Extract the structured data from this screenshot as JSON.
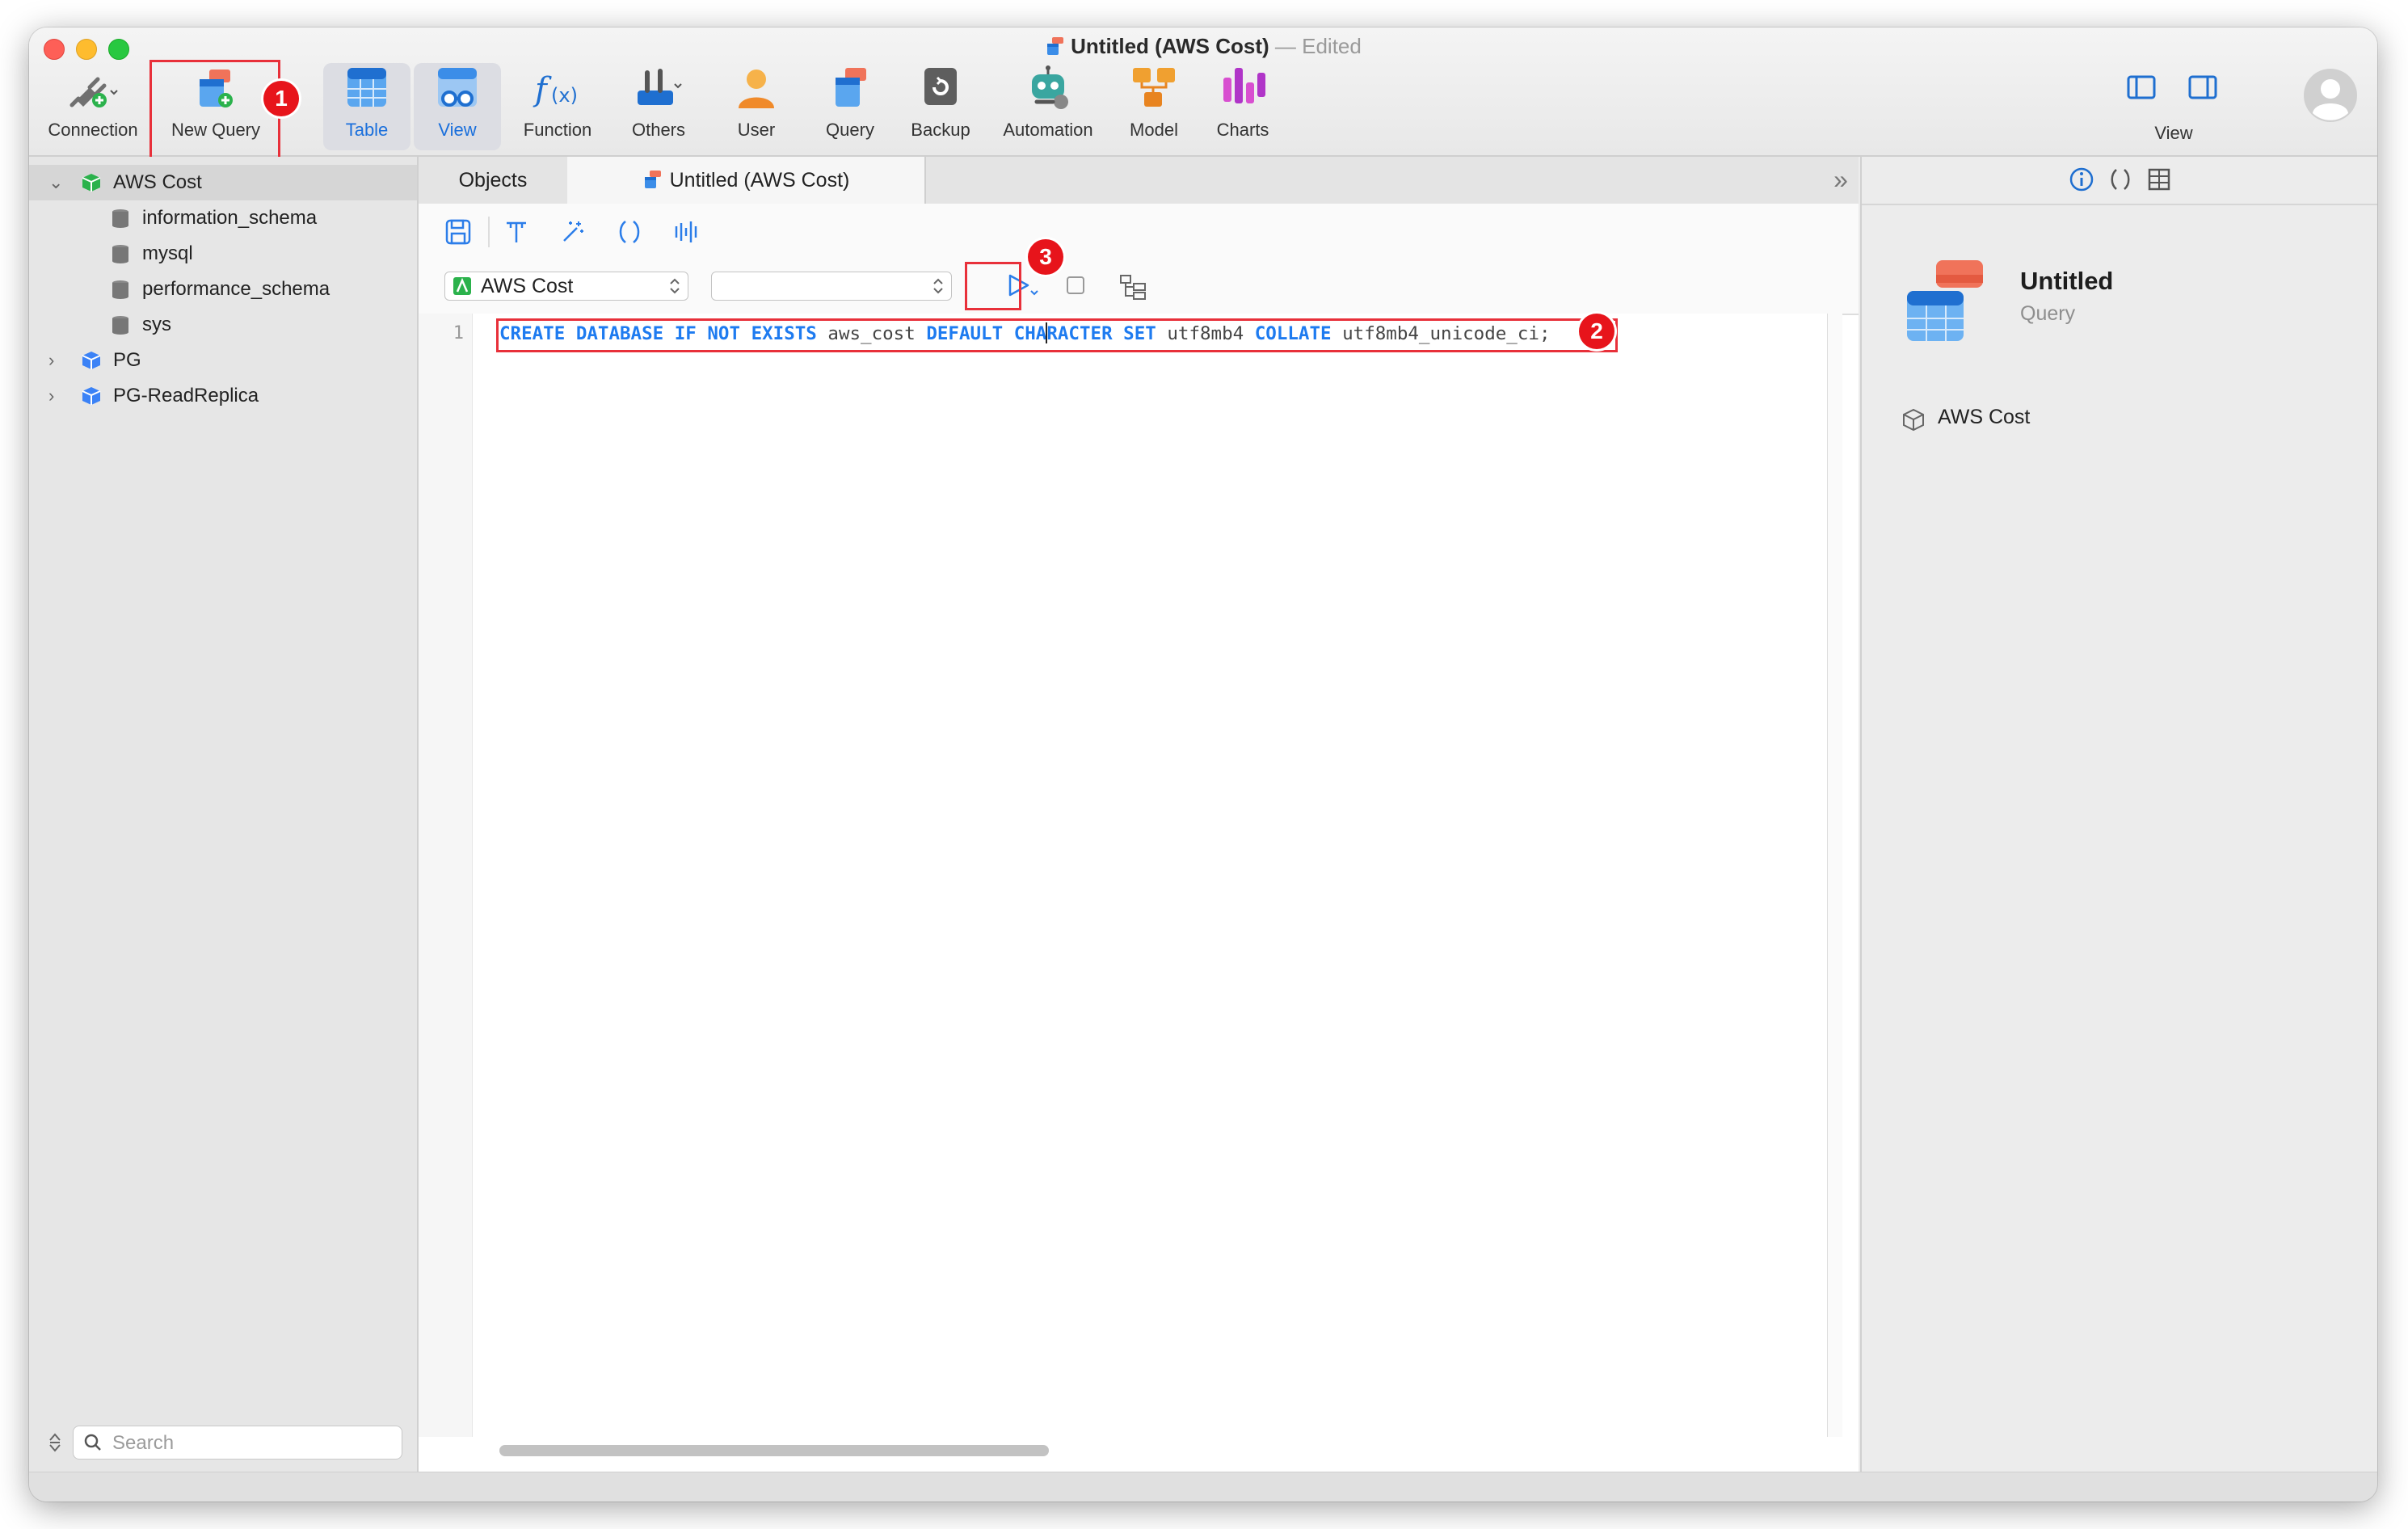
{
  "window": {
    "title": "Untitled (AWS Cost)",
    "status": "— Edited"
  },
  "toolbar": {
    "connection": "Connection",
    "new_query": "New Query",
    "table": "Table",
    "view": "View",
    "function": "Function",
    "others": "Others",
    "user": "User",
    "query": "Query",
    "backup": "Backup",
    "automation": "Automation",
    "model": "Model",
    "charts": "Charts",
    "view_right": "View"
  },
  "annotations": {
    "step1": "1",
    "step2": "2",
    "step3": "3"
  },
  "sidebar": {
    "connections": [
      {
        "label": "AWS Cost",
        "expanded": true,
        "color": "#2bb24c"
      },
      {
        "label": "PG",
        "expanded": false,
        "color": "#3b82f6"
      },
      {
        "label": "PG-ReadReplica",
        "expanded": false,
        "color": "#3b82f6"
      }
    ],
    "databases": [
      "information_schema",
      "mysql",
      "performance_schema",
      "sys"
    ],
    "search_placeholder": "Search"
  },
  "tabs": {
    "objects": "Objects",
    "query": "Untitled (AWS Cost)"
  },
  "query_toolbar": {
    "connection_select": "AWS Cost",
    "database_select": ""
  },
  "editor": {
    "line_number": "1",
    "tokens": [
      {
        "t": "CREATE",
        "kw": true
      },
      {
        "t": " "
      },
      {
        "t": "DATABASE",
        "kw": true
      },
      {
        "t": " "
      },
      {
        "t": "IF",
        "kw": true
      },
      {
        "t": " "
      },
      {
        "t": "NOT",
        "kw": true
      },
      {
        "t": " "
      },
      {
        "t": "EXISTS",
        "kw": true
      },
      {
        "t": " aws_cost "
      },
      {
        "t": "DEFAULT",
        "kw": true
      },
      {
        "t": " "
      },
      {
        "t": "CHA",
        "kw": true
      },
      {
        "caret": true
      },
      {
        "t": "RACTER",
        "kw": true
      },
      {
        "t": " "
      },
      {
        "t": "SET",
        "kw": true
      },
      {
        "t": " utf8mb4 "
      },
      {
        "t": "COLLATE",
        "kw": true
      },
      {
        "t": " utf8mb4_unicode_ci;"
      }
    ]
  },
  "inspector": {
    "title": "Untitled",
    "subtitle": "Query",
    "connection": "AWS Cost"
  },
  "colors": {
    "accent": "#1a6fdc",
    "keyword": "#1e7bf0",
    "highlight": "#e8303a",
    "badge": "#e7141b"
  }
}
